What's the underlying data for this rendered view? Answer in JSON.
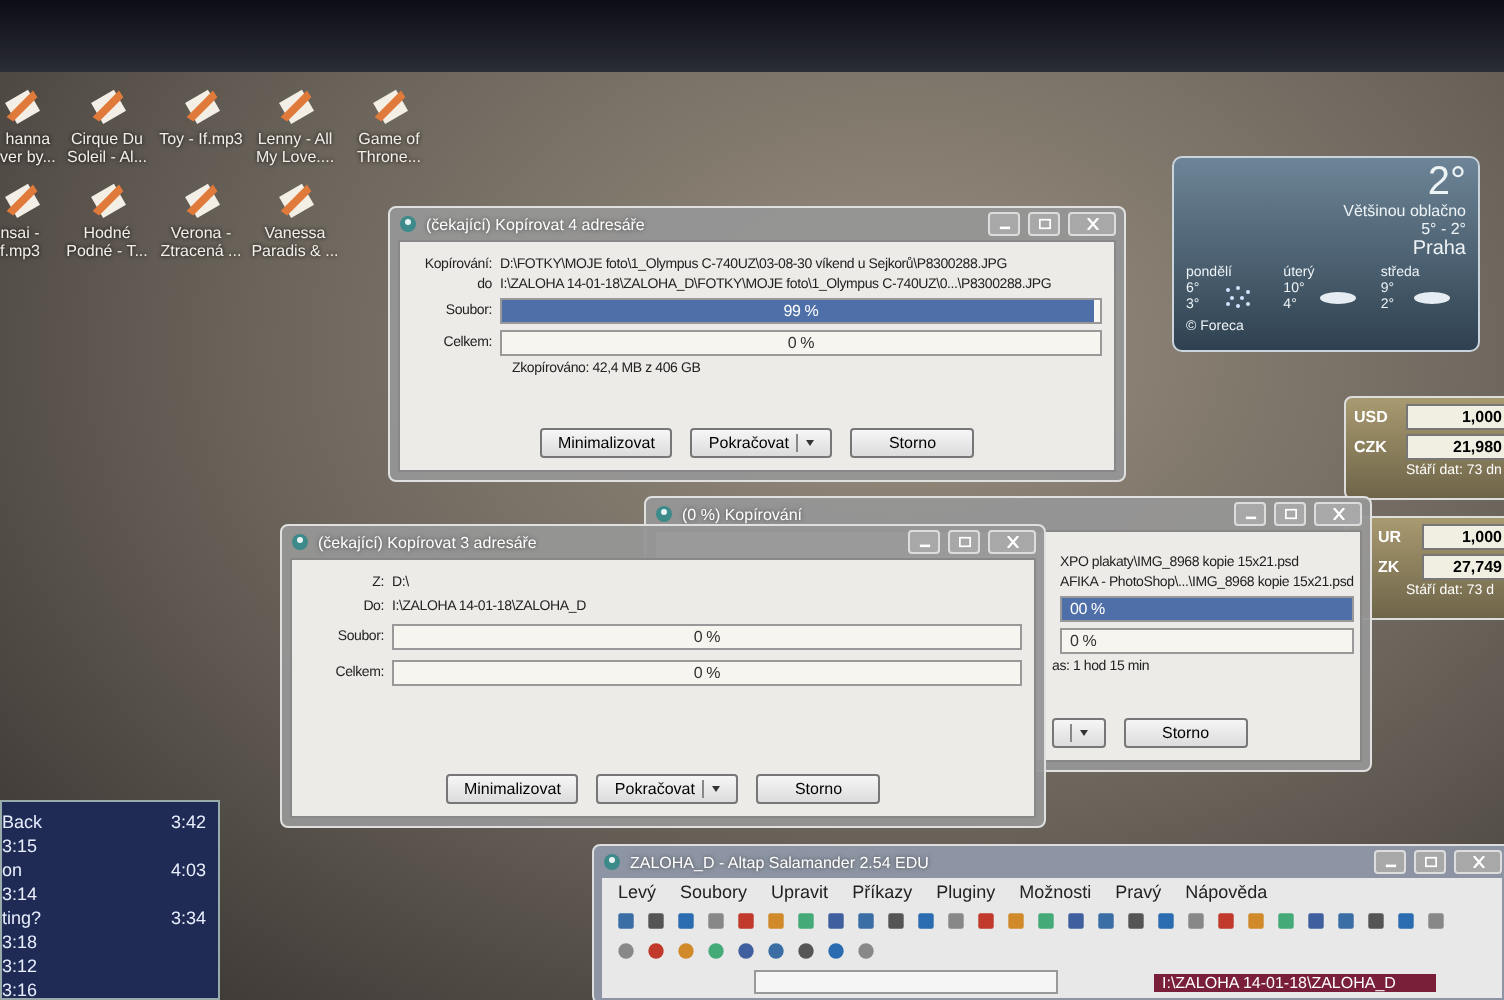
{
  "desktop_icons": [
    {
      "label": "hanna\nver by..."
    },
    {
      "label": "Cirque Du\nSoleil - Al..."
    },
    {
      "label": "Toy - If.mp3"
    },
    {
      "label": "Lenny - All\nMy Love...."
    },
    {
      "label": "Game of\nThrone..."
    },
    {
      "label": "nsai -\nf.mp3"
    },
    {
      "label": "Hodné\nPodné - T..."
    },
    {
      "label": "Verona -\nZtracená ..."
    },
    {
      "label": "Vanessa\nParadis & ..."
    }
  ],
  "weather": {
    "temperature": "2°",
    "condition": "Většinou oblačno",
    "range": "5° - 2°",
    "city": "Praha",
    "days": [
      {
        "name": "pondělí",
        "high": "6°",
        "low": "3°",
        "kind": "snow"
      },
      {
        "name": "úterý",
        "high": "10°",
        "low": "4°",
        "kind": "cloud"
      },
      {
        "name": "středa",
        "high": "9°",
        "low": "2°",
        "kind": "cloud"
      }
    ],
    "credit": "© Foreca"
  },
  "currency_gadgets": [
    {
      "rows": [
        {
          "code": "USD",
          "value": "1,000"
        },
        {
          "code": "CZK",
          "value": "21,980"
        }
      ],
      "note": "Stáří dat: 73 dn"
    },
    {
      "rows": [
        {
          "code": "UR",
          "value": "1,000"
        },
        {
          "code": "ZK",
          "value": "27,749"
        }
      ],
      "note": "Stáří dat: 73 d"
    }
  ],
  "windows": [
    {
      "title": "(čekající) Kopírovat 4 adresáře",
      "lines": [
        {
          "label": "Kopírování:",
          "value": "D:\\FOTKY\\MOJE foto\\1_Olympus C-740UZ\\03-08-30 víkend u Sejkorů\\P8300288.JPG"
        },
        {
          "label": "do",
          "value": "I:\\ZALOHA 14-01-18\\ZALOHA_D\\FOTKY\\MOJE foto\\1_Olympus C-740UZ\\0...\\P8300288.JPG"
        }
      ],
      "bars": [
        {
          "label": "Soubor:",
          "level": 0.99,
          "reading": "99 %"
        },
        {
          "label": "Celkem:",
          "level": 0,
          "reading": "0 %"
        }
      ],
      "status": "Zkopírováno: 42,4 MB z 406 GB",
      "buttons": [
        {
          "kind": "button",
          "label": "Minimalizovat"
        },
        {
          "kind": "split",
          "label": "Pokračovat"
        },
        {
          "kind": "button",
          "label": "Storno"
        }
      ]
    },
    {
      "title": "(0 %) Kopírování",
      "lines": [
        {
          "value": "XPO plakaty\\IMG_8968 kopie 15x21.psd"
        },
        {
          "value": "AFIKA - PhotoShop\\...\\IMG_8968 kopie 15x21.psd"
        }
      ],
      "bars": [
        {
          "level": 1,
          "reading": "00 %"
        },
        {
          "level": 0,
          "reading": "0 %"
        }
      ],
      "status": "as: 1 hod 15 min",
      "buttons": [
        {
          "kind": "split_tail"
        },
        {
          "kind": "button",
          "label": "Storno"
        }
      ]
    },
    {
      "title": "(čekající) Kopírovat 3 adresáře",
      "lines": [
        {
          "label": "Z:",
          "value": "D:\\"
        },
        {
          "label": "Do:",
          "value": "I:\\ZALOHA 14-01-18\\ZALOHA_D"
        }
      ],
      "bars": [
        {
          "label": "Soubor:",
          "level": 0,
          "reading": "0 %"
        },
        {
          "label": "Celkem:",
          "level": 0,
          "reading": "0 %"
        }
      ],
      "buttons": [
        {
          "kind": "button",
          "label": "Minimalizovat"
        },
        {
          "kind": "split",
          "label": "Pokračovat"
        },
        {
          "kind": "button",
          "label": "Storno"
        }
      ]
    }
  ],
  "playlist": {
    "tracks": [
      {
        "title": "Back",
        "time": "3:42"
      },
      {
        "time": "3:15"
      },
      {
        "title": "on",
        "time": "4:03"
      },
      {
        "time": "3:14"
      },
      {
        "title": "ting?",
        "time": "3:34"
      },
      {
        "time": "3:18"
      },
      {
        "time": "3:12"
      },
      {
        "time": "3:16"
      }
    ]
  },
  "file_manager": {
    "title": "ZALOHA_D - Altap Salamander 2.54 EDU",
    "menu": [
      "Levý",
      "Soubory",
      "Upravit",
      "Příkazy",
      "Pluginy",
      "Možnosti",
      "Pravý",
      "Nápověda"
    ],
    "path": "I:\\ZALOHA 14-01-18\\ZALOHA_D"
  }
}
